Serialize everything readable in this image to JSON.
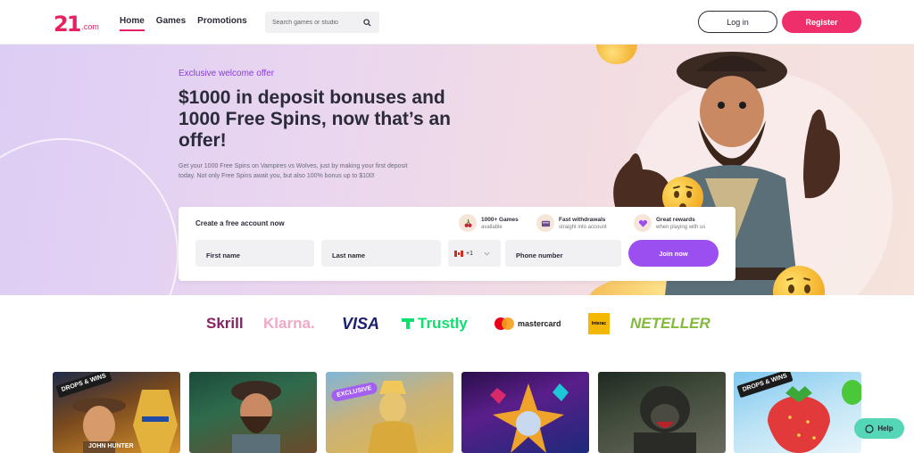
{
  "brand": {
    "logo_mark": "21",
    "logo_suffix": ".com",
    "accent": "#ee2f6b",
    "purple": "#9b4ff0"
  },
  "header": {
    "nav": [
      "Home",
      "Games",
      "Promotions"
    ],
    "active_nav": "Home",
    "search_placeholder": "Search games or studio",
    "login_label": "Log in",
    "register_label": "Register"
  },
  "hero": {
    "eyebrow": "Exclusive welcome offer",
    "headline": "$1000 in deposit bonuses and 1000 Free Spins, now that’s an offer!",
    "subtext": "Get your 1000 Free Spins on Vampires vs Wolves, just by making your first deposit today. Not only Free Spins await you, but also 100% bonus up to $100!"
  },
  "signup": {
    "title": "Create a free account now",
    "perks": [
      {
        "title": "1000+ Games",
        "sub": "available",
        "icon": "cherries-icon"
      },
      {
        "title": "Fast withdrawals",
        "sub": "straight into account",
        "icon": "wallet-icon"
      },
      {
        "title": "Great rewards",
        "sub": "when playing with us",
        "icon": "heart-icon"
      }
    ],
    "first_name_placeholder": "First name",
    "last_name_placeholder": "Last name",
    "country_code": "+1",
    "phone_placeholder": "Phone number",
    "join_label": "Join now"
  },
  "payments": {
    "skrill": "Skrill",
    "klarna": "Klarna.",
    "visa": "VISA",
    "trustly": "Trustly",
    "mastercard": "mastercard",
    "interac": "Interac",
    "neteller": "NETELLER"
  },
  "games": {
    "drops_badge": "DROPS & WINS",
    "exclusive_badge": "EXCLUSIVE",
    "tile1_title": "JOHN HUNTER"
  },
  "help": {
    "label": "Help"
  }
}
